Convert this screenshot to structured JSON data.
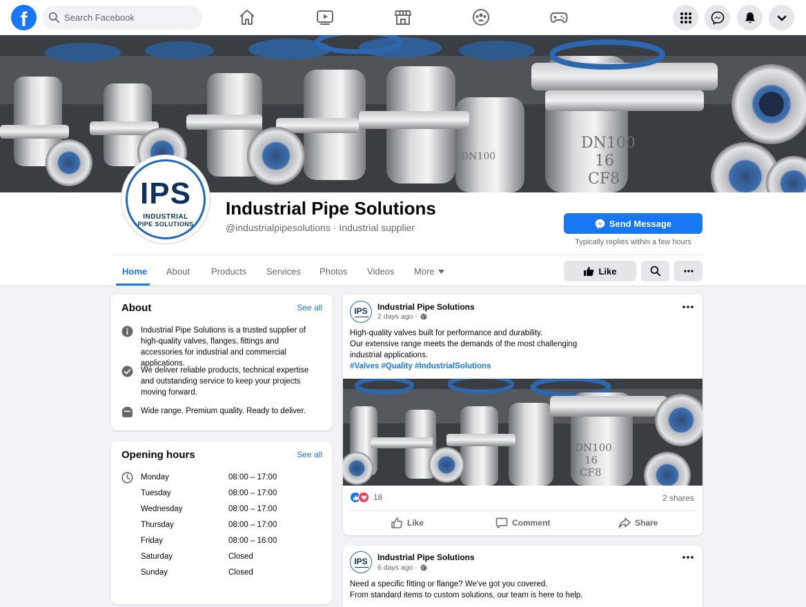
{
  "topbar": {
    "logo": "f",
    "search_placeholder": "Search Facebook",
    "nav_icons": [
      "home-icon",
      "video-icon",
      "marketplace-icon",
      "groups-icon",
      "gaming-icon"
    ],
    "right_icons": [
      "menu-grid-icon",
      "messenger-icon",
      "notifications-bell-icon",
      "account-chevron-icon"
    ]
  },
  "profile": {
    "avatar": {
      "initials": "IPS",
      "line1": "INDUSTRIAL",
      "line2": "PIPE SOLUTIONS"
    },
    "name": "Industrial Pipe Solutions",
    "handle": "@industrialpipesolutions · Industrial supplier",
    "send_message": "Send Message",
    "reply_note": "Typically replies within a few hours",
    "tabs": [
      "Home",
      "About",
      "Products",
      "Services",
      "Photos",
      "Videos",
      "More"
    ],
    "active_tab": "Home",
    "like_label": "Like"
  },
  "cover_labels": {
    "big": "DN100",
    "n16": "16",
    "cf8": "CF8",
    "small": "DN100"
  },
  "about": {
    "title": "About",
    "see_all": "See all",
    "items": [
      {
        "icon": "info-icon",
        "text": "Industrial Pipe Solutions is a trusted supplier of high-quality valves, flanges, fittings and accessories for industrial and commercial applications."
      },
      {
        "icon": "verified-check-icon",
        "text": "We deliver reliable products, technical expertise and outstanding service to keep your projects moving forward."
      },
      {
        "icon": "shop-icon",
        "text": "Wide range. Premium quality. Ready to deliver."
      }
    ]
  },
  "hours": {
    "title": "Opening hours",
    "see_all": "See all",
    "rows": [
      {
        "day": "Monday",
        "time": "08:00 – 17:00"
      },
      {
        "day": "Tuesday",
        "time": "08:00 – 17:00"
      },
      {
        "day": "Wednesday",
        "time": "08:00 – 17:00"
      },
      {
        "day": "Thursday",
        "time": "08:00 – 17:00"
      },
      {
        "day": "Friday",
        "time": "08:00 – 16:00"
      },
      {
        "day": "Saturday",
        "time": "Closed"
      },
      {
        "day": "Sunday",
        "time": "Closed"
      }
    ]
  },
  "posts": [
    {
      "author": "Industrial Pipe Solutions",
      "time": "2 days ago ·",
      "lines": [
        "High-quality valves built for performance and durability.",
        "Our extensive range meets the demands of the most challenging",
        "industrial applications."
      ],
      "hashtags": "#Valves #Quality #IndustrialSolutions",
      "reactions": "18",
      "shares": "2 shares",
      "actions": {
        "like": "Like",
        "comment": "Comment",
        "share": "Share"
      }
    },
    {
      "author": "Industrial Pipe Solutions",
      "time": "6 days ago ·",
      "lines": [
        "Need a specific fitting or flange? We've got you covered.",
        "From standard items to custom solutions, our team is here to help."
      ]
    }
  ],
  "colors": {
    "brand": "#1877f2",
    "page_bg": "#f0f2f5",
    "logo_navy": "#0f2f5e"
  }
}
